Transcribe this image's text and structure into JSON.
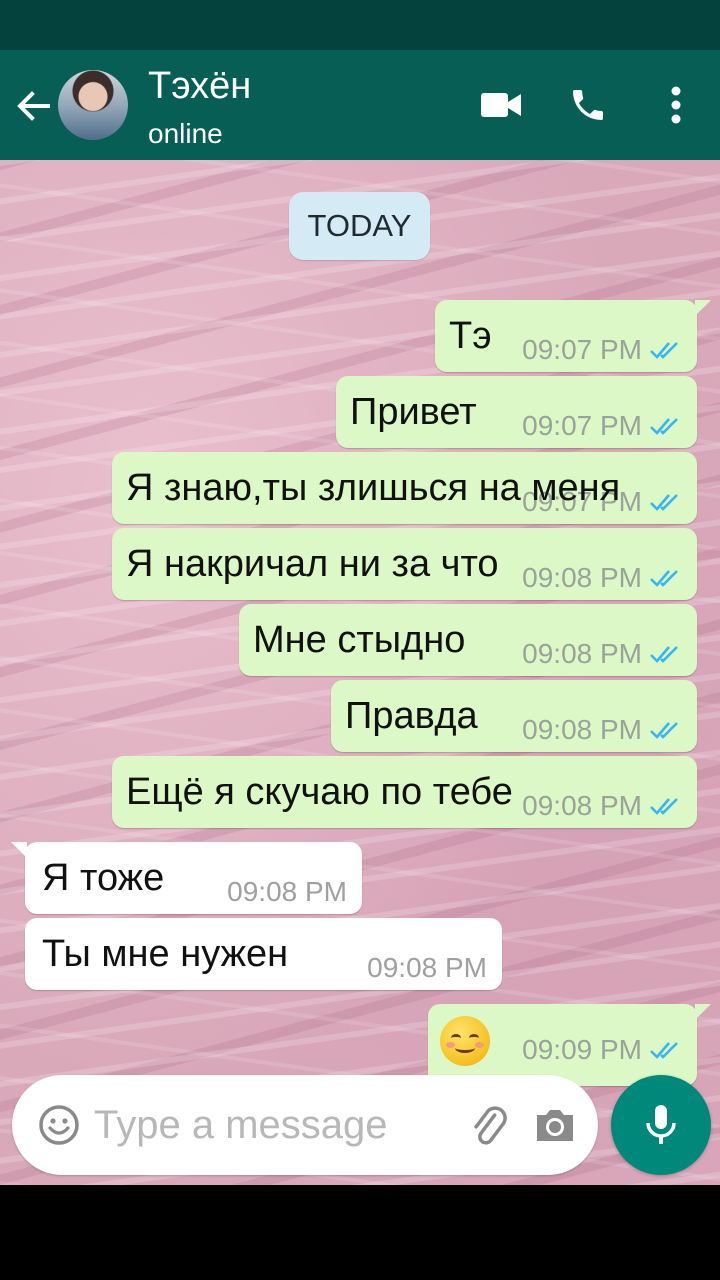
{
  "header": {
    "contact_name": "Тэхён",
    "contact_status": "online"
  },
  "chat": {
    "date_label": "TODAY",
    "messages": [
      {
        "dir": "out",
        "text": "Тэ",
        "time": "09:07 PM"
      },
      {
        "dir": "out",
        "text": "Привет",
        "time": "09:07 PM"
      },
      {
        "dir": "out",
        "text": "Я знаю,ты злишься на меня",
        "time": "09:07 PM"
      },
      {
        "dir": "out",
        "text": "Я накричал ни за что",
        "time": "09:08 PM"
      },
      {
        "dir": "out",
        "text": "Мне стыдно",
        "time": "09:08 PM"
      },
      {
        "dir": "out",
        "text": "Правда",
        "time": "09:08 PM"
      },
      {
        "dir": "out",
        "text": "Ещё я скучаю по тебе",
        "time": "09:08 PM"
      },
      {
        "dir": "in",
        "text": "Я тоже",
        "time": "09:08 PM"
      },
      {
        "dir": "in",
        "text": "Ты мне нужен",
        "time": "09:08 PM"
      },
      {
        "dir": "out",
        "emoji": "smiling-face-icon",
        "time": "09:09 PM"
      }
    ]
  },
  "composer": {
    "placeholder": "Type a message"
  },
  "colors": {
    "header": "#075e54",
    "status_bar": "#04433d",
    "outgoing_bubble": "#dcf8c6",
    "incoming_bubble": "#ffffff",
    "read_ticks": "#34b7f1",
    "mic_button": "#00897b"
  }
}
